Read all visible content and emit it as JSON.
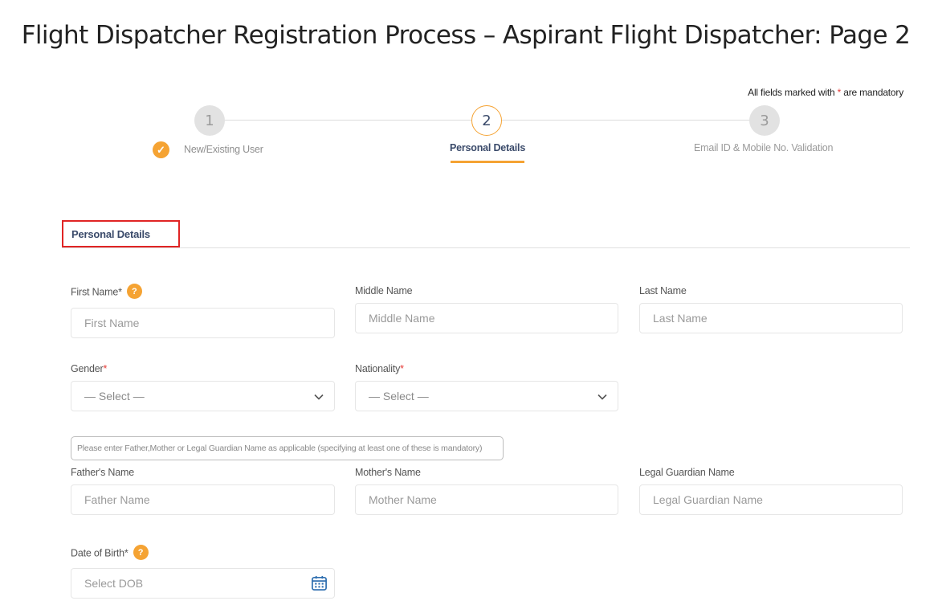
{
  "slide_title": "Flight Dispatcher Registration Process – Aspirant Flight Dispatcher: Page 2",
  "mandatory_note": {
    "prefix": "All fields marked with",
    "star": "*",
    "suffix": "are mandatory"
  },
  "stepper": {
    "steps": [
      {
        "number": "1",
        "label": "New/Existing User",
        "state": "completed"
      },
      {
        "number": "2",
        "label": "Personal Details",
        "state": "active"
      },
      {
        "number": "3",
        "label": "Email ID & Mobile No. Validation",
        "state": "pending"
      }
    ],
    "check_glyph": "✓"
  },
  "section": {
    "title": "Personal Details"
  },
  "help_glyph": "?",
  "fields": {
    "first_name": {
      "label": "First Name",
      "required_mark": "*",
      "placeholder": "First Name"
    },
    "middle_name": {
      "label": "Middle Name",
      "placeholder": "Middle Name"
    },
    "last_name": {
      "label": "Last Name",
      "placeholder": "Last Name"
    },
    "gender": {
      "label": "Gender",
      "required_mark": "*",
      "selected": "— Select —"
    },
    "nationality": {
      "label": "Nationality",
      "required_mark": "*",
      "selected": "— Select —"
    },
    "guardian_info": "Please enter Father,Mother or Legal Guardian Name as applicable (specifying at least one of these is mandatory)",
    "father_name": {
      "label": "Father's Name",
      "placeholder": "Father Name"
    },
    "mother_name": {
      "label": "Mother's Name",
      "placeholder": "Mother Name"
    },
    "guardian_name": {
      "label": "Legal Guardian Name",
      "placeholder": "Legal Guardian Name"
    },
    "dob": {
      "label": "Date of Birth",
      "required_mark": "*",
      "placeholder": "Select DOB"
    }
  },
  "colors": {
    "accent": "#f5a333",
    "highlight_box": "#e02424",
    "required": "#e53935",
    "heading_text": "#3a4a6a"
  },
  "icons": {
    "help": "question-circle-icon",
    "check": "check-circle-icon",
    "dropdown": "chevron-down-icon",
    "calendar": "calendar-icon"
  }
}
